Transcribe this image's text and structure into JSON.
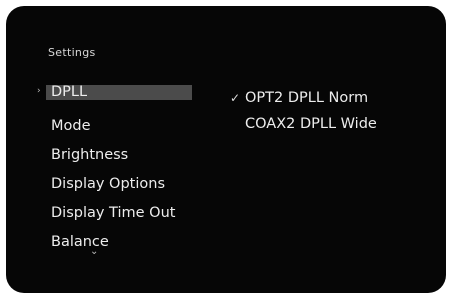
{
  "settings_title": "Settings",
  "menu": {
    "items": [
      {
        "label": "DPLL",
        "selected": true
      },
      {
        "label": "Mode",
        "selected": false
      },
      {
        "label": "Brightness",
        "selected": false
      },
      {
        "label": "Display Options",
        "selected": false
      },
      {
        "label": "Display Time Out",
        "selected": false
      },
      {
        "label": "Balance",
        "selected": false
      }
    ],
    "selected_marker": "›",
    "more_indicator": "⌄"
  },
  "options": {
    "items": [
      {
        "label": "OPT2 DPLL Norm",
        "checked": true
      },
      {
        "label": "COAX2 DPLL Wide",
        "checked": false
      }
    ],
    "check_mark": "✓"
  },
  "colors": {
    "screen_bg": "#060606",
    "highlight": "#4b4b4b",
    "text": "#ededed"
  }
}
